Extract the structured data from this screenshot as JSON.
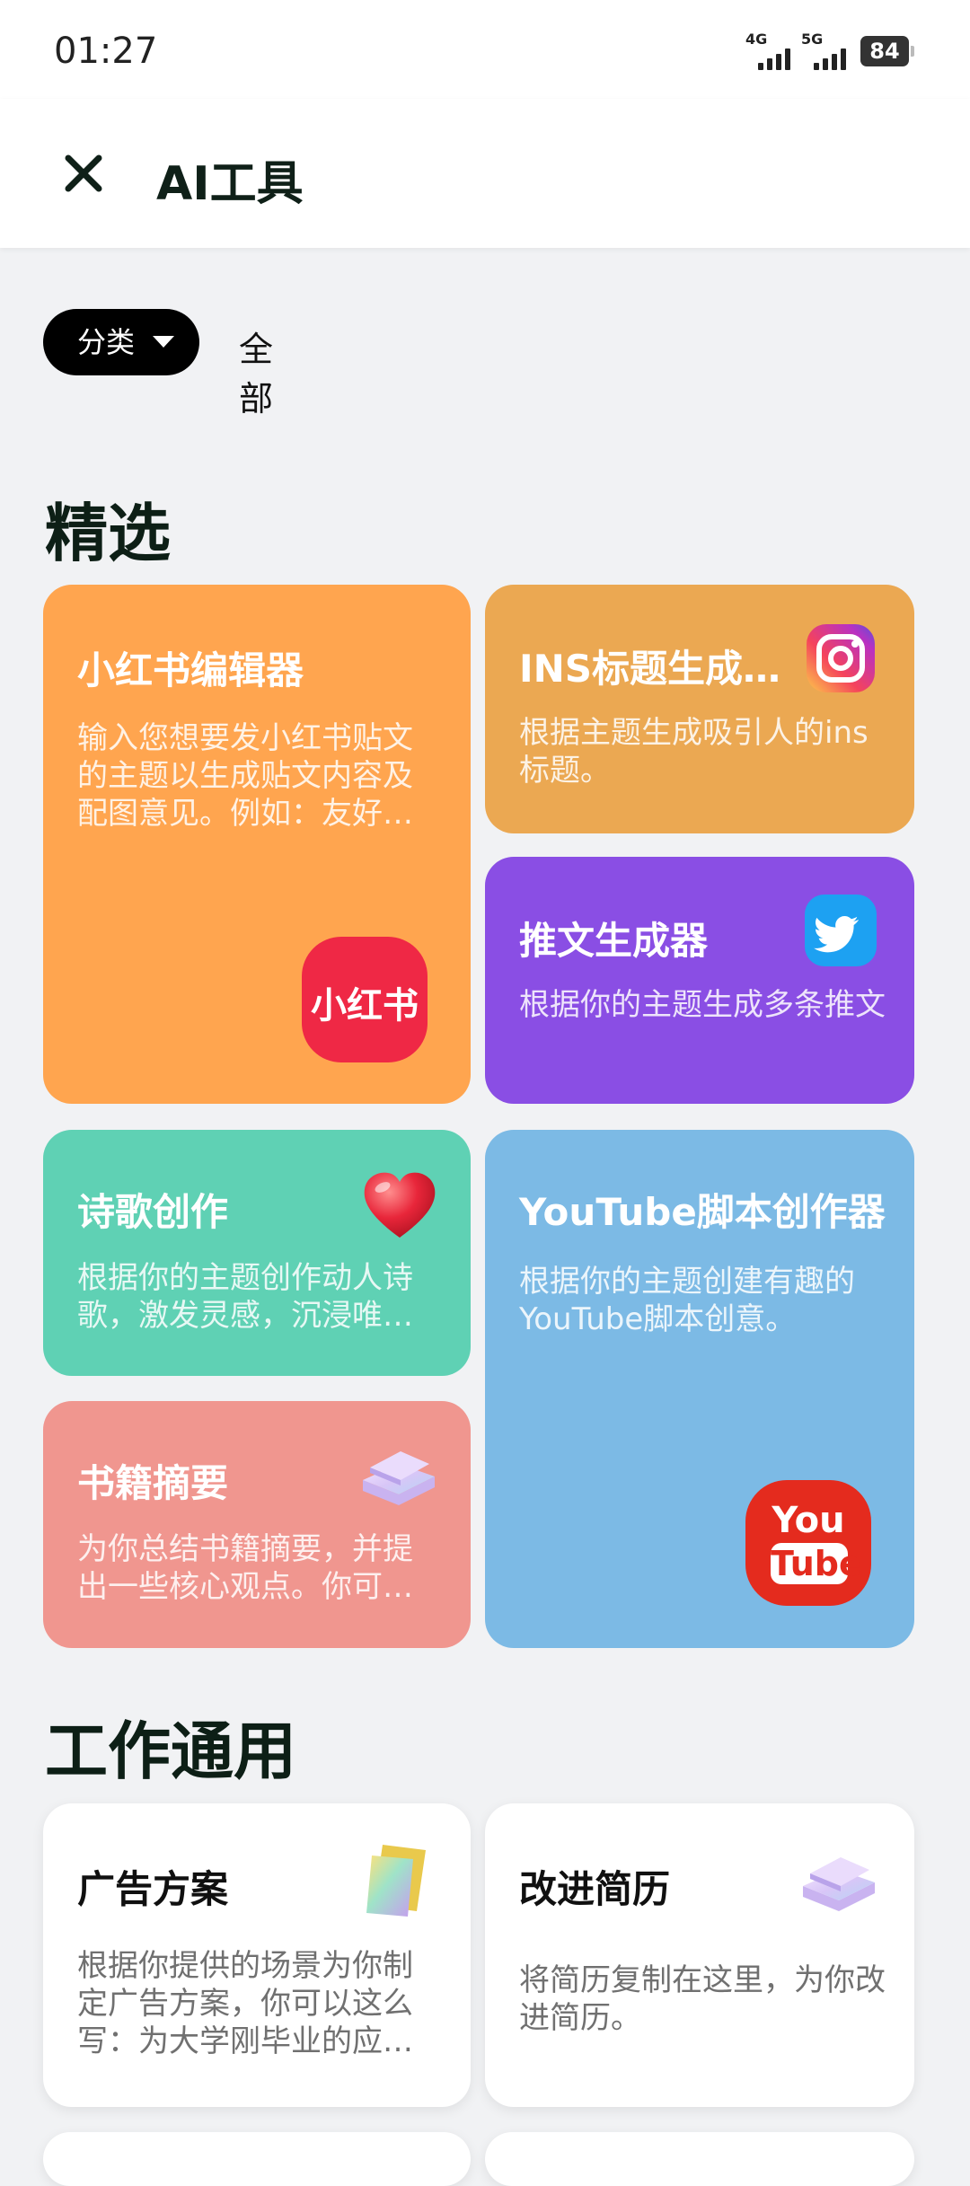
{
  "status_bar": {
    "time": "01:27",
    "net1": "4G",
    "net2": "5G",
    "battery": "84"
  },
  "app_bar": {
    "title": "AI工具"
  },
  "filter": {
    "category_label": "分类",
    "all_label": "全部"
  },
  "sections": [
    {
      "title": "精选",
      "cards": [
        {
          "title": "小红书编辑器",
          "desc": "输入您想要发小红书贴文的主题以生成贴文内容及配图意见。例如：友好…",
          "color": "#FFA54F",
          "icon": "xiaohongshu-logo-icon",
          "icon_text": "小红书"
        },
        {
          "title": "INS标题生成…",
          "desc": "根据主题生成吸引人的ins标题。",
          "color": "#EBA852",
          "icon": "instagram-logo-icon"
        },
        {
          "title": "推文生成器",
          "desc": "根据你的主题生成多条推文",
          "color": "#8A4EE4",
          "icon": "twitter-bird-icon"
        },
        {
          "title": "诗歌创作",
          "desc": "根据你的主题创作动人诗歌，激发灵感，沉浸唯…",
          "color": "#5FD1B4",
          "icon": "heart-icon"
        },
        {
          "title": "YouTube脚本创作器",
          "desc": "根据你的主题创建有趣的YouTube脚本创意。",
          "color": "#7CBAE5",
          "icon": "youtube-logo-icon",
          "icon_text_1": "You",
          "icon_text_2": "Tube"
        },
        {
          "title": "书籍摘要",
          "desc": "为你总结书籍摘要，并提出一些核心观点。你可…",
          "color": "#F0968F",
          "icon": "books-icon"
        }
      ]
    },
    {
      "title": "工作通用",
      "cards": [
        {
          "title": "广告方案",
          "desc": "根据你提供的场景为你制定广告方案，你可以这么写：为大学刚毕业的应…",
          "icon": "folder-icon"
        },
        {
          "title": "改进简历",
          "desc": "将简历复制在这里，为你改进简历。",
          "icon": "books-icon"
        }
      ]
    }
  ]
}
